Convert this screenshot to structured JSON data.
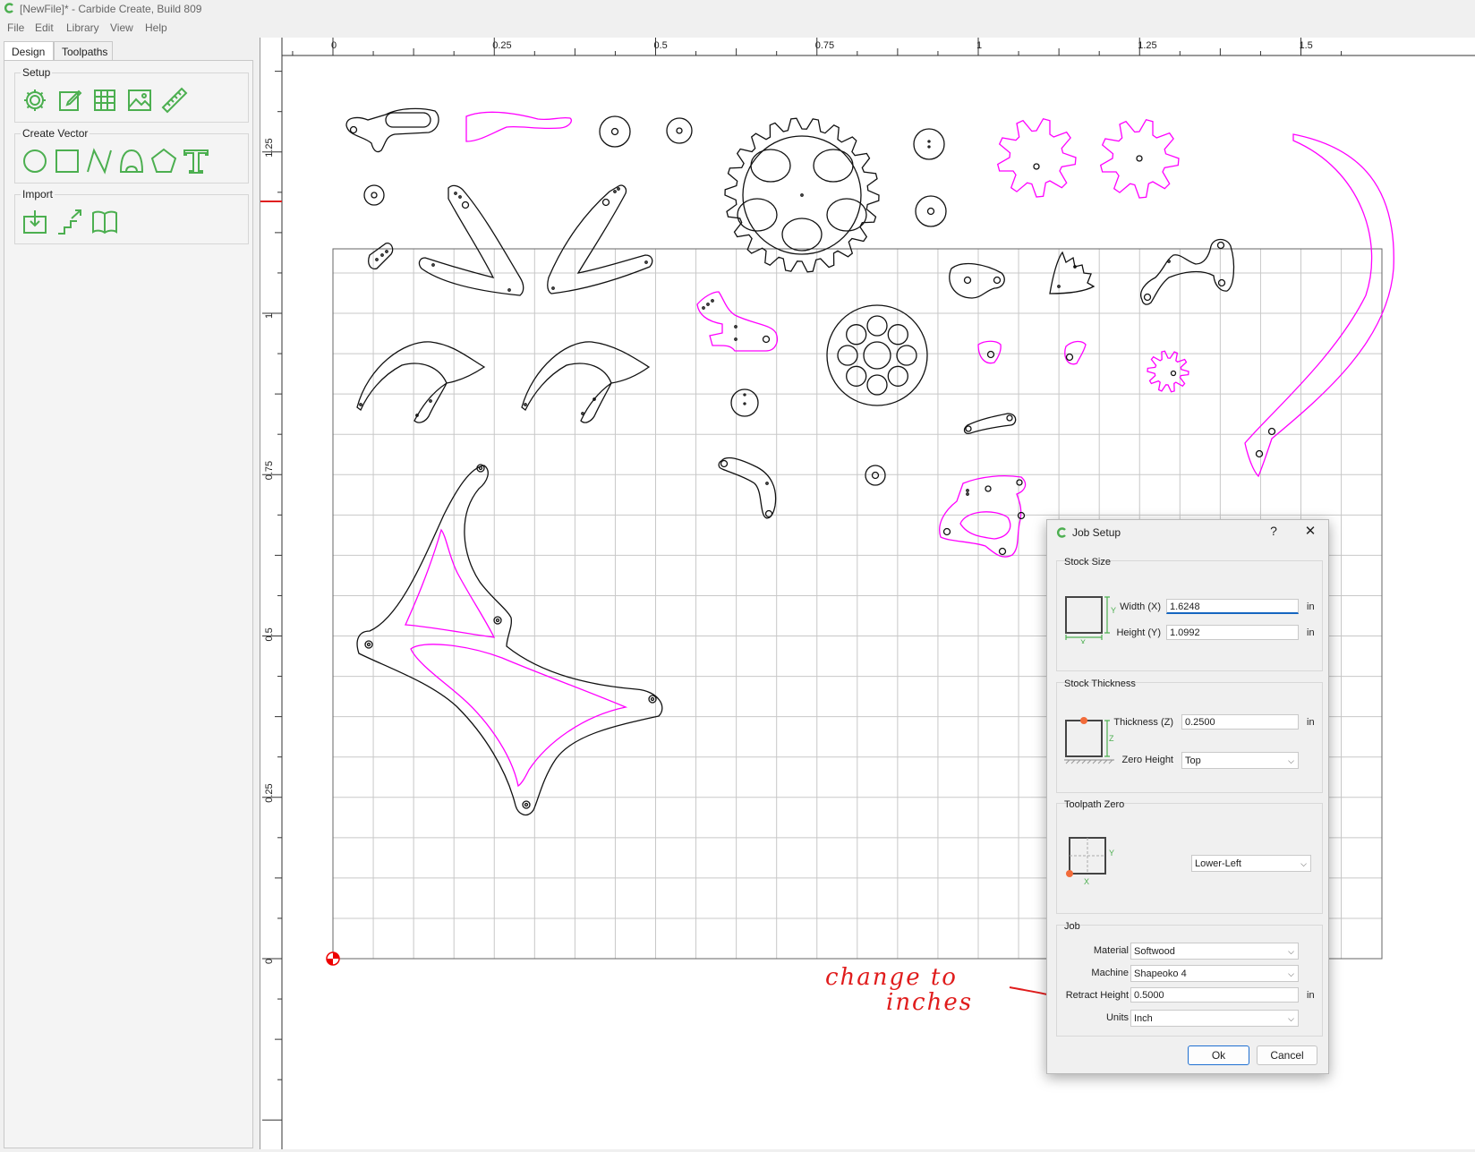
{
  "window": {
    "title": "[NewFile]* - Carbide Create, Build 809"
  },
  "menu": [
    "File",
    "Edit",
    "Library",
    "View",
    "Help"
  ],
  "tabs": [
    "Design",
    "Toolpaths"
  ],
  "groups": {
    "setup": "Setup",
    "create_vector": "Create Vector",
    "import": "Import"
  },
  "ruler": {
    "x_labels": [
      "0",
      "0.25",
      "0.5",
      "0.75",
      "1",
      "1.25",
      "1.5"
    ],
    "y_labels": [
      "1.25",
      "1",
      "0.75",
      "0.5",
      "0.25",
      "0"
    ]
  },
  "dialog": {
    "title": "Job Setup",
    "help": "?",
    "close": "✕",
    "stock_size": {
      "label": "Stock Size",
      "width_label": "Width (X)",
      "width_value": "1.6248",
      "width_unit": "in",
      "height_label": "Height (Y)",
      "height_value": "1.0992",
      "height_unit": "in"
    },
    "stock_thickness": {
      "label": "Stock Thickness",
      "thickness_label": "Thickness (Z)",
      "thickness_value": "0.2500",
      "thickness_unit": "in",
      "zero_height_label": "Zero Height",
      "zero_height_value": "Top"
    },
    "toolpath_zero": {
      "label": "Toolpath Zero",
      "value": "Lower-Left"
    },
    "job": {
      "label": "Job",
      "material_label": "Material",
      "material_value": "Softwood",
      "machine_label": "Machine",
      "machine_value": "Shapeoko 4",
      "retract_label": "Retract Height",
      "retract_value": "0.5000",
      "retract_unit": "in",
      "units_label": "Units",
      "units_value": "Inch"
    },
    "ok": "Ok",
    "cancel": "Cancel"
  },
  "annotation": {
    "line1": "change to",
    "line2": "inches"
  },
  "colors": {
    "accent": "#4caf50",
    "magenta": "#ff00ff",
    "annotation": "#e01c1c",
    "origin": "#ff0000"
  }
}
